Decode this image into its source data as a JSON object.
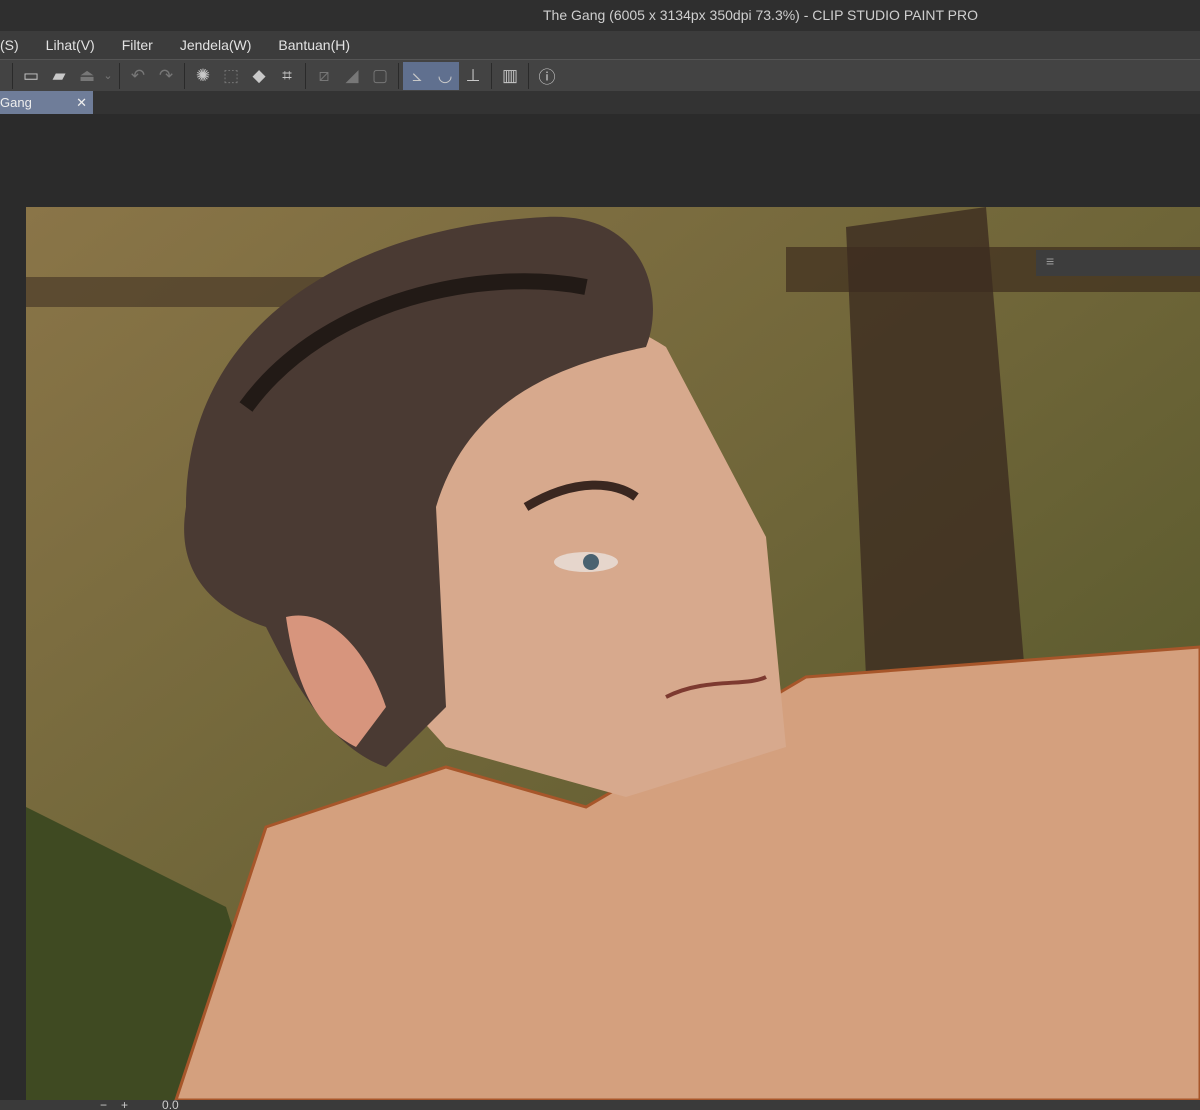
{
  "window": {
    "title": "The Gang (6005 x 3134px 350dpi 73.3%)  - CLIP STUDIO PAINT PRO"
  },
  "menu": [
    "(S)",
    "Lihat(V)",
    "Filter",
    "Jendela(W)",
    "Bantuan(H)"
  ],
  "toolbar": {
    "icons": [
      "new-file-icon",
      "open-file-icon",
      "save-icon",
      "undo-icon",
      "redo-icon",
      "clear-selection-icon",
      "invert-selection-icon",
      "fill-icon",
      "transform-icon",
      "snap-ruler-icon",
      "snap-special-ruler-icon",
      "snap-grid-icon",
      "ruler-toggle-icon",
      "special-ruler-icon",
      "perspective-ruler-icon",
      "companion-mode-icon",
      "help-icon"
    ]
  },
  "tab": {
    "label": "Gang",
    "close": "✕"
  },
  "panel": {
    "menu_icon": "≡"
  },
  "status": {
    "minus": "−",
    "plus": "+",
    "value": "0.0"
  }
}
